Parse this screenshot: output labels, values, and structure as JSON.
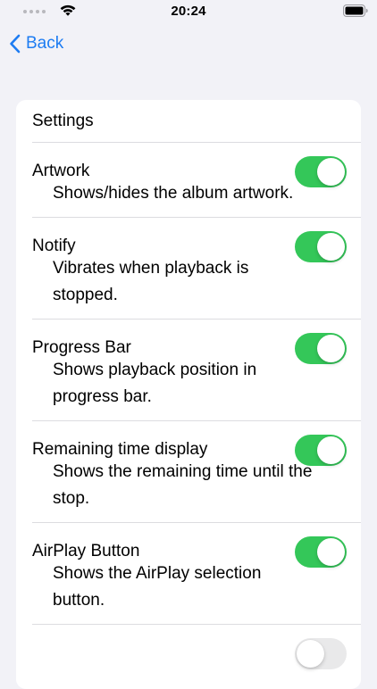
{
  "status_bar": {
    "time": "20:24"
  },
  "nav": {
    "back_label": "Back"
  },
  "colors": {
    "accent": "#1d7cf2",
    "toggle_on": "#34c759",
    "toggle_off": "#e9e9ea",
    "background": "#f2f2f7"
  },
  "settings": {
    "header": "Settings",
    "items": [
      {
        "title": "Artwork",
        "description": "Shows/hides the album artwork.",
        "enabled": true
      },
      {
        "title": "Notify",
        "description": "Vibrates when playback is stopped.",
        "enabled": true
      },
      {
        "title": "Progress Bar",
        "description": "Shows playback position in progress bar.",
        "enabled": true
      },
      {
        "title": "Remaining time display",
        "description": "Shows the remaining time until the stop.",
        "enabled": true
      },
      {
        "title": "AirPlay Button",
        "description": "Shows the AirPlay selection button.",
        "enabled": true
      },
      {
        "title": "",
        "description": "",
        "enabled": false
      }
    ]
  }
}
